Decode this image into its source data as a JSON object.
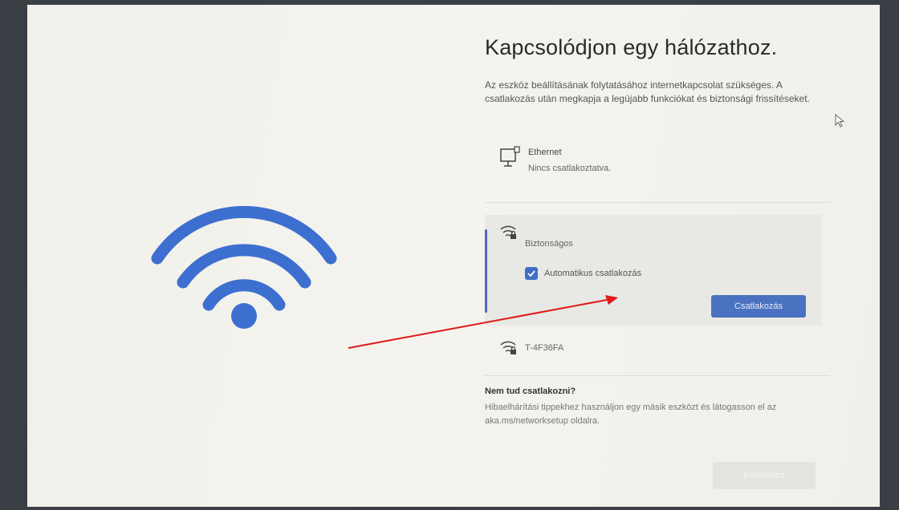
{
  "setup": {
    "title": "Kapcsolódjon egy hálózathoz.",
    "description": "Az eszköz beállításának folytatásához internetkapcsolat szükséges. A csatlakozás után megkapja a legújabb funkciókat és biztonsági frissítéseket.",
    "ethernet": {
      "name": "Ethernet",
      "status": "Nincs csatlakoztatva."
    },
    "selected_network": {
      "security": "Biztonságos",
      "auto_connect_label": "Automatikus csatlakozás",
      "auto_connect_checked": true,
      "connect_label": "Csatlakozás"
    },
    "other_network": {
      "name": "T-4F36FA"
    },
    "help": {
      "title": "Nem tud csatlakozni?",
      "text": "Hibaelhárítási tippekhez használjon egy másik eszközt és látogasson el az aka.ms/networksetup oldalra."
    },
    "next_label": "Következő"
  },
  "colors": {
    "accent": "#4a72c0",
    "wifi_art": "#3d6fd0",
    "annotation_arrow": "#e01818"
  }
}
